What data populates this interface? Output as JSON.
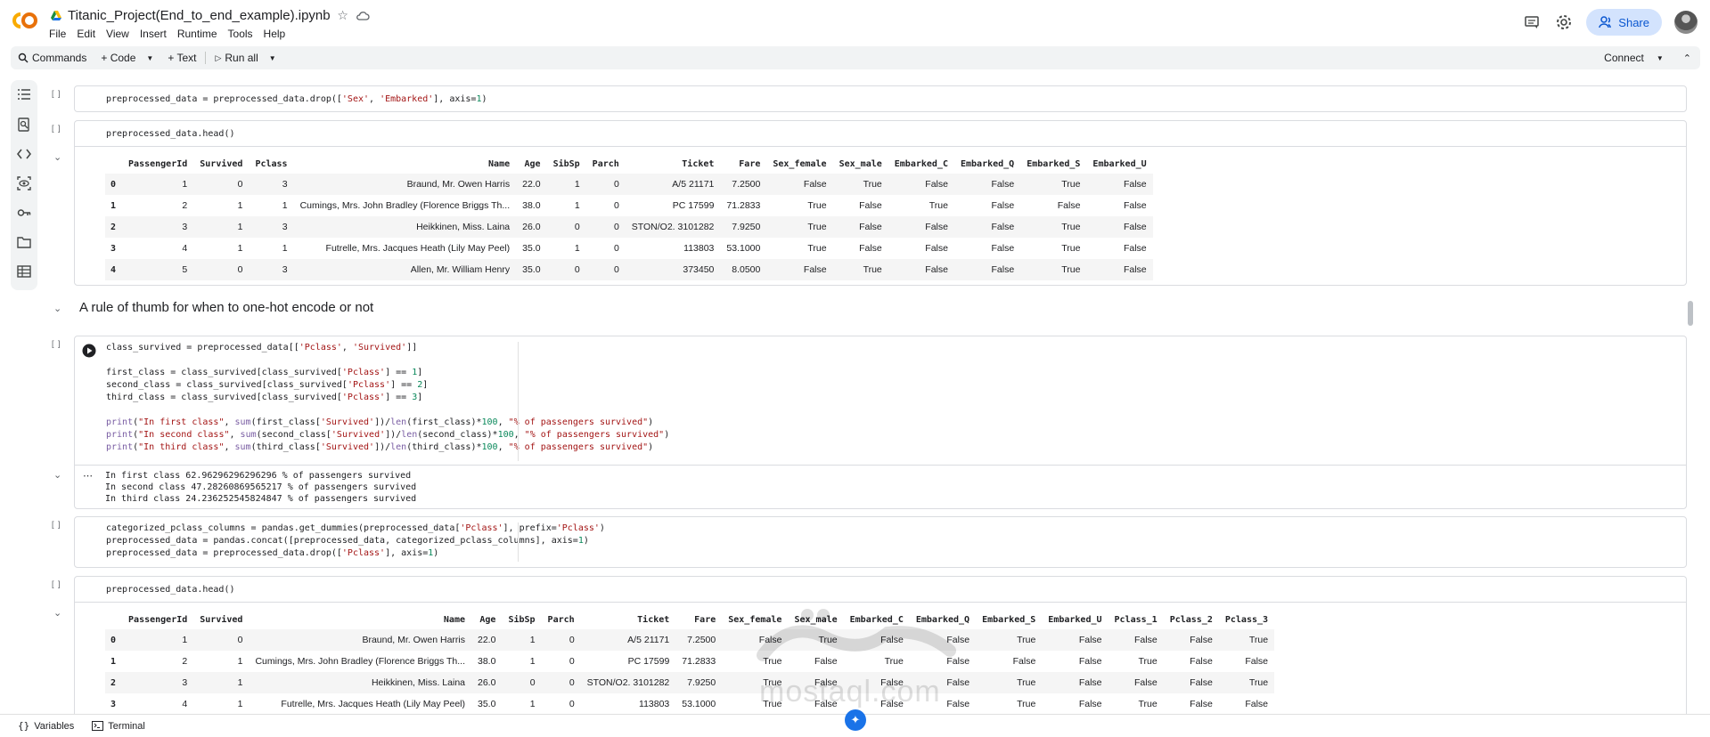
{
  "header": {
    "notebook_title": "Titanic_Project(End_to_end_example).ipynb",
    "menu": [
      "File",
      "Edit",
      "View",
      "Insert",
      "Runtime",
      "Tools",
      "Help"
    ],
    "share_label": "Share",
    "brand_colors": {
      "orange": "#F9AB00",
      "accent": "#0b57d0"
    }
  },
  "toolbar": {
    "commands_label": "Commands",
    "code_label": "+ Code",
    "text_label": "+ Text",
    "run_all_label": "Run all",
    "connect_label": "Connect"
  },
  "cells": {
    "c1": {
      "bracket": "[ ]"
    },
    "c2": {
      "bracket": "[ ]",
      "code": "preprocessed_data.head()"
    },
    "c3": {
      "bracket": "[ ]",
      "output": "In first class 62.96296296296296 % of passengers survived\nIn second class 47.28260869565217 % of passengers survived\nIn third class 24.236252545824847 % of passengers survived"
    },
    "c4": {
      "bracket": "[ ]"
    },
    "c5": {
      "bracket": "[ ]",
      "code": "preprocessed_data.head()"
    }
  },
  "section_title": "A rule of thumb for when to one-hot encode or not",
  "table1": {
    "columns": [
      "",
      "PassengerId",
      "Survived",
      "Pclass",
      "Name",
      "Age",
      "SibSp",
      "Parch",
      "Ticket",
      "Fare",
      "Sex_female",
      "Sex_male",
      "Embarked_C",
      "Embarked_Q",
      "Embarked_S",
      "Embarked_U"
    ],
    "rows": [
      [
        "0",
        "1",
        "0",
        "3",
        "Braund, Mr. Owen Harris",
        "22.0",
        "1",
        "0",
        "A/5 21171",
        "7.2500",
        "False",
        "True",
        "False",
        "False",
        "True",
        "False"
      ],
      [
        "1",
        "2",
        "1",
        "1",
        "Cumings, Mrs. John Bradley (Florence Briggs Th...",
        "38.0",
        "1",
        "0",
        "PC 17599",
        "71.2833",
        "True",
        "False",
        "True",
        "False",
        "False",
        "False"
      ],
      [
        "2",
        "3",
        "1",
        "3",
        "Heikkinen, Miss. Laina",
        "26.0",
        "0",
        "0",
        "STON/O2. 3101282",
        "7.9250",
        "True",
        "False",
        "False",
        "False",
        "True",
        "False"
      ],
      [
        "3",
        "4",
        "1",
        "1",
        "Futrelle, Mrs. Jacques Heath (Lily May Peel)",
        "35.0",
        "1",
        "0",
        "113803",
        "53.1000",
        "True",
        "False",
        "False",
        "False",
        "True",
        "False"
      ],
      [
        "4",
        "5",
        "0",
        "3",
        "Allen, Mr. William Henry",
        "35.0",
        "0",
        "0",
        "373450",
        "8.0500",
        "False",
        "True",
        "False",
        "False",
        "True",
        "False"
      ]
    ]
  },
  "table2": {
    "columns": [
      "",
      "PassengerId",
      "Survived",
      "Name",
      "Age",
      "SibSp",
      "Parch",
      "Ticket",
      "Fare",
      "Sex_female",
      "Sex_male",
      "Embarked_C",
      "Embarked_Q",
      "Embarked_S",
      "Embarked_U",
      "Pclass_1",
      "Pclass_2",
      "Pclass_3"
    ],
    "rows": [
      [
        "0",
        "1",
        "0",
        "Braund, Mr. Owen Harris",
        "22.0",
        "1",
        "0",
        "A/5 21171",
        "7.2500",
        "False",
        "True",
        "False",
        "False",
        "True",
        "False",
        "False",
        "False",
        "True"
      ],
      [
        "1",
        "2",
        "1",
        "Cumings, Mrs. John Bradley (Florence Briggs Th...",
        "38.0",
        "1",
        "0",
        "PC 17599",
        "71.2833",
        "True",
        "False",
        "True",
        "False",
        "False",
        "False",
        "True",
        "False",
        "False"
      ],
      [
        "2",
        "3",
        "1",
        "Heikkinen, Miss. Laina",
        "26.0",
        "0",
        "0",
        "STON/O2. 3101282",
        "7.9250",
        "True",
        "False",
        "False",
        "False",
        "True",
        "False",
        "False",
        "False",
        "True"
      ],
      [
        "3",
        "4",
        "1",
        "Futrelle, Mrs. Jacques Heath (Lily May Peel)",
        "35.0",
        "1",
        "0",
        "113803",
        "53.1000",
        "True",
        "False",
        "False",
        "False",
        "True",
        "False",
        "True",
        "False",
        "False"
      ]
    ]
  },
  "bottombar": {
    "variables_label": "Variables",
    "terminal_label": "Terminal"
  },
  "watermark": {
    "text": "mostaql.com"
  }
}
